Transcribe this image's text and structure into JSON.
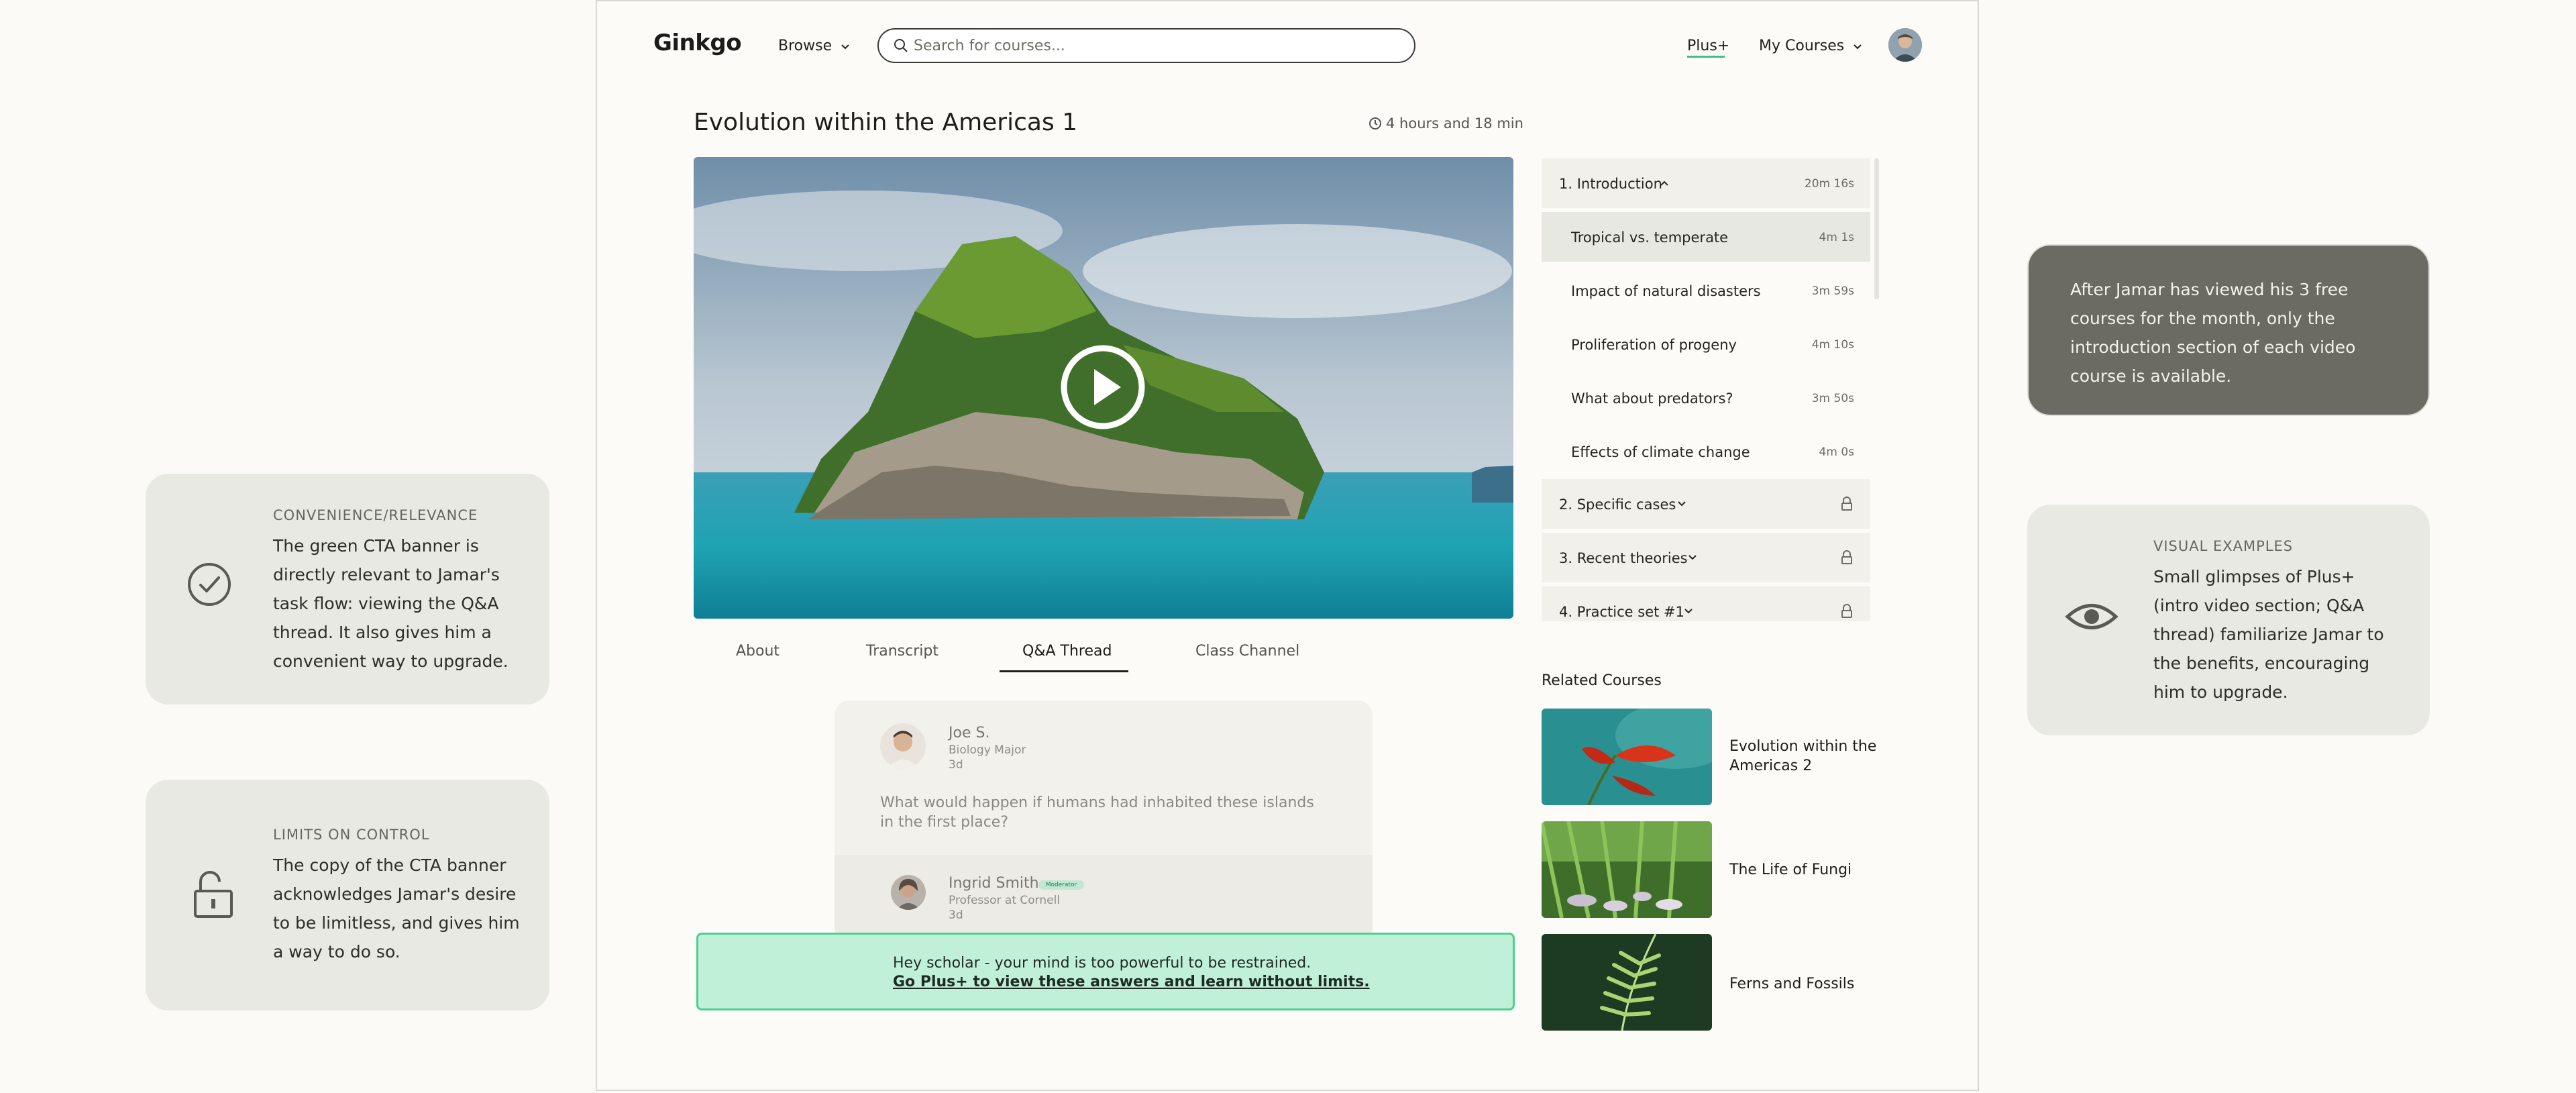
{
  "header": {
    "logo": "Ginkgo",
    "browse": "Browse",
    "search_placeholder": "Search for courses...",
    "plus": "Plus+",
    "my_courses": "My Courses"
  },
  "course": {
    "title": "Evolution within the Americas 1",
    "duration": "4 hours and 18 min"
  },
  "tabs": [
    "About",
    "Transcript",
    "Q&A Thread",
    "Class Channel"
  ],
  "active_tab": "Q&A Thread",
  "qa": {
    "question": {
      "name": "Joe S.",
      "role": "Biology Major",
      "age": "3d",
      "text": "What would happen if humans had inhabited these islands in the first place?"
    },
    "reply": {
      "name": "Ingrid Smith",
      "badge": "Moderator",
      "role": "Professor at Cornell",
      "age": "3d"
    }
  },
  "cta": {
    "line1": "Hey scholar - your mind is too powerful to be restrained.",
    "line2": "Go Plus+ to view these answers and learn without limits."
  },
  "toc": {
    "sections": [
      {
        "label": "1. Introduction",
        "time": "20m 16s",
        "expanded": true
      },
      {
        "label": "2. Specific cases",
        "locked": true
      },
      {
        "label": "3. Recent theories",
        "locked": true
      },
      {
        "label": "4. Practice set #1",
        "locked": true
      }
    ],
    "lessons": [
      {
        "label": "Tropical vs. temperate",
        "time": "4m 1s",
        "selected": true
      },
      {
        "label": "Impact of natural disasters",
        "time": "3m 59s"
      },
      {
        "label": "Proliferation of progeny",
        "time": "4m 10s"
      },
      {
        "label": "What about predators?",
        "time": "3m 50s"
      },
      {
        "label": "Effects of climate change",
        "time": "4m 0s"
      }
    ]
  },
  "related": {
    "heading": "Related Courses",
    "items": [
      {
        "title": "Evolution within the Americas 2"
      },
      {
        "title": "The Life of Fungi"
      },
      {
        "title": "Ferns and Fossils"
      }
    ]
  },
  "notes": {
    "convenience": {
      "tag": "CONVENIENCE/RELEVANCE",
      "text": "The green CTA banner is directly relevant to Jamar's task flow: viewing the Q&A thread. It also gives him a convenient way to upgrade."
    },
    "limits": {
      "tag": "LIMITS ON CONTROL",
      "text": "The copy of the CTA banner acknowledges Jamar's desire to be limitless, and gives him a way to do so."
    },
    "free_courses": {
      "text": "After Jamar has viewed his 3 free courses for the month, only the introduction section of each video course is available."
    },
    "visual": {
      "tag": "VISUAL EXAMPLES",
      "text": "Small glimpses of Plus+ (intro video section; Q&A thread) familiarize Jamar to the benefits, encouraging him to upgrade."
    }
  },
  "colors": {
    "accent_green": "#4bcf92",
    "cta_bg": "#c1f0d9",
    "dark_note": "#6b6b63",
    "note_bg": "#e9e9e4"
  }
}
